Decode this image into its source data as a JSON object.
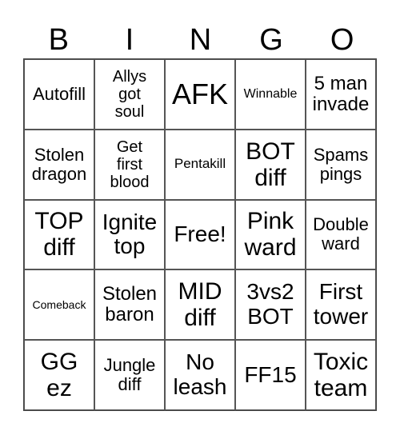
{
  "header": [
    "B",
    "I",
    "N",
    "G",
    "O"
  ],
  "cells": [
    "Autofill",
    "Allys got soul",
    "AFK",
    "Winnable",
    "5 man invade",
    "Stolen dragon",
    "Get first blood",
    "Pentakill",
    "BOT diff",
    "Spams pings",
    "TOP diff",
    "Ignite top",
    "Free!",
    "Pink ward",
    "Double ward",
    "Comeback",
    "Stolen baron",
    "MID diff",
    "3vs2 BOT",
    "First tower",
    "GG ez",
    "Jungle diff",
    "No leash",
    "FF15",
    "Toxic team"
  ]
}
